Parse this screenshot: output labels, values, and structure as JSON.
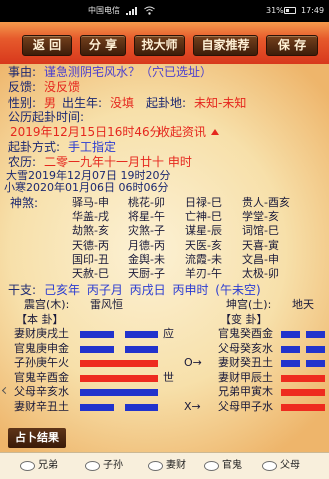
{
  "status_bar": {
    "carrier": "中国电信",
    "battery": "31%",
    "time": "17:49",
    "icons": [
      "signal-icon",
      "wifi-icon",
      "battery-icon"
    ]
  },
  "toolbar": {
    "back": "返 回",
    "share": "分 享",
    "find_master": "找大师",
    "recommend": "自家推荐",
    "save": "保 存"
  },
  "info": {
    "reason_label": "事由:",
    "reason_value": "谨急测阴宅风水？（穴已选址）",
    "feedback_label": "反馈:",
    "feedback_value": "没反馈",
    "gender_label": "性别:",
    "gender_value": "男",
    "birth_year_label": "出生年:",
    "birth_year_value": "没填",
    "location_label": "起卦地:",
    "location_value": "未知-未知",
    "solar_time_label": "公历起卦时间:",
    "solar_time_value": "2019年12月15日16时46分",
    "collapse_label": "收起资讯",
    "collapse_icon": "triangle-up-icon",
    "method_label": "起卦方式:",
    "method_value": "手工指定",
    "lunar_label": "农历:",
    "lunar_value": "二零一九年十一月廿十 申时",
    "term1": "大雪2019年12月07日 19时20分",
    "term2": "小寒2020年01月06日 06时06分"
  },
  "shensha": {
    "label": "神煞:",
    "items": [
      "驿马-申",
      "桃花-卯",
      "日禄-巳",
      "贵人-酉亥",
      "华盖-戌",
      "将星-午",
      "亡神-巳",
      "学堂-亥",
      "劫煞-亥",
      "灾煞-子",
      "谋星-辰",
      "词馆-巳",
      "天德-丙",
      "月德-丙",
      "天医-亥",
      "天喜-寅",
      "国印-丑",
      "金舆-未",
      "流霞-未",
      "文昌-申",
      "天赦-巳",
      "天厨-子",
      "羊刃-午",
      "太极-卯"
    ]
  },
  "ganzhi": {
    "label": "干支:",
    "value": "己亥年 丙子月 丙戌日 丙申时 (午未空)"
  },
  "hexagram": {
    "main_palace": "震宫(木):",
    "main_name": "雷风恒",
    "changed_palace": "坤宫(土):",
    "changed_name": "地天",
    "main_title": "【本 卦】",
    "changed_title": "【变 卦】",
    "lines": [
      {
        "main": "妻财庚戌土",
        "main_type": "yin",
        "main_color": "#2233cc",
        "marker": "应",
        "moving": "",
        "changed": "官鬼癸酉金",
        "changed_type": "yin",
        "changed_color": "#2233cc"
      },
      {
        "main": "官鬼庚申金",
        "main_type": "yin",
        "main_color": "#2233cc",
        "marker": "",
        "moving": "",
        "changed": "父母癸亥水",
        "changed_type": "yin",
        "changed_color": "#2233cc"
      },
      {
        "main": "子孙庚午火",
        "main_type": "yang",
        "main_color": "#ee2b1f",
        "marker": "",
        "moving": "O→",
        "changed": "妻财癸丑土",
        "changed_type": "yin",
        "changed_color": "#2233cc"
      },
      {
        "main": "官鬼辛酉金",
        "main_type": "yang",
        "main_color": "#ee2b1f",
        "marker": "世",
        "moving": "",
        "changed": "妻财甲辰土",
        "changed_type": "yang",
        "changed_color": "#ee2b1f"
      },
      {
        "main": "父母辛亥水",
        "main_type": "yang",
        "main_color": "#2233cc",
        "marker": "",
        "moving": "",
        "changed": "兄弟甲寅木",
        "changed_type": "yang",
        "changed_color": "#ee2b1f"
      },
      {
        "main": "妻财辛丑土",
        "main_type": "yin",
        "main_color": "#2233cc",
        "marker": "",
        "moving": "X→",
        "changed": "父母甲子水",
        "changed_type": "yang",
        "changed_color": "#ee2b1f"
      }
    ]
  },
  "result_button": "占卜结果",
  "legend": [
    "兄弟",
    "子孙",
    "妻财",
    "官鬼",
    "父母"
  ],
  "colors": {
    "label": "#1c2870",
    "red": "#e5271e",
    "blue": "#2a3bd2",
    "purple": "#4b3fcf",
    "dark": "#1a1a3a"
  }
}
